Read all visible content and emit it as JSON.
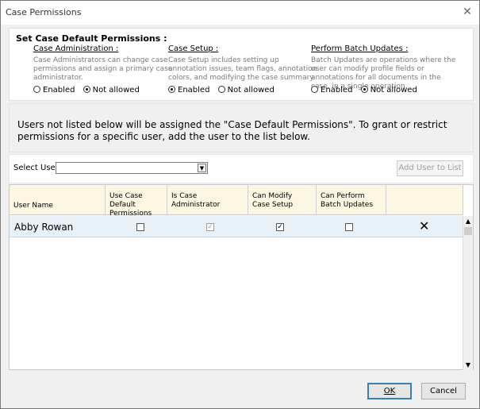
{
  "window": {
    "title": "Case Permissions",
    "close_glyph": "✕"
  },
  "defaults": {
    "title": "Set Case Default Permissions :",
    "columns": [
      {
        "heading": "Case Administration :",
        "description": "Case Administrators can change case permissions and assign a primary case administrator.",
        "enabled_label": "Enabled",
        "not_allowed_label": "Not allowed",
        "selected": "not_allowed"
      },
      {
        "heading": "Case Setup :",
        "description": "Case Setup includes setting up annotation issues, team flags, annotation colors, and modifying the case summary.",
        "enabled_label": "Enabled",
        "not_allowed_label": "Not allowed",
        "selected": "enabled"
      },
      {
        "heading": "Perform Batch Updates :",
        "description": "Batch Updates are operations where the user can modify profile fields or annotations for all documents in the case, in a single operation.",
        "enabled_label": "Enabled",
        "not_allowed_label": "Not allowed",
        "selected": "not_allowed"
      }
    ]
  },
  "info": {
    "text": "Users not listed below will be assigned the \"Case Default Permissions\".  To grant or restrict permissions for a specific user, add the user to the list below."
  },
  "select_user": {
    "label": "Select User :",
    "value": "",
    "arrow_glyph": "▼",
    "add_button_label": "Add User to List"
  },
  "grid": {
    "columns": [
      "User Name",
      "Use Case Default Permissions",
      "Is Case Administrator",
      "Can Modify Case Setup",
      "Can Perform Batch Updates",
      ""
    ],
    "rows": [
      {
        "user_name": "Abby Rowan",
        "use_defaults": false,
        "is_admin": true,
        "can_modify_setup": true,
        "can_batch_update": false,
        "delete_glyph": "✕"
      }
    ],
    "scroll_up_glyph": "▲",
    "scroll_down_glyph": "▼"
  },
  "footer": {
    "ok_label": "OK",
    "cancel_label": "Cancel"
  },
  "icons": {
    "check_glyph": "✓"
  }
}
